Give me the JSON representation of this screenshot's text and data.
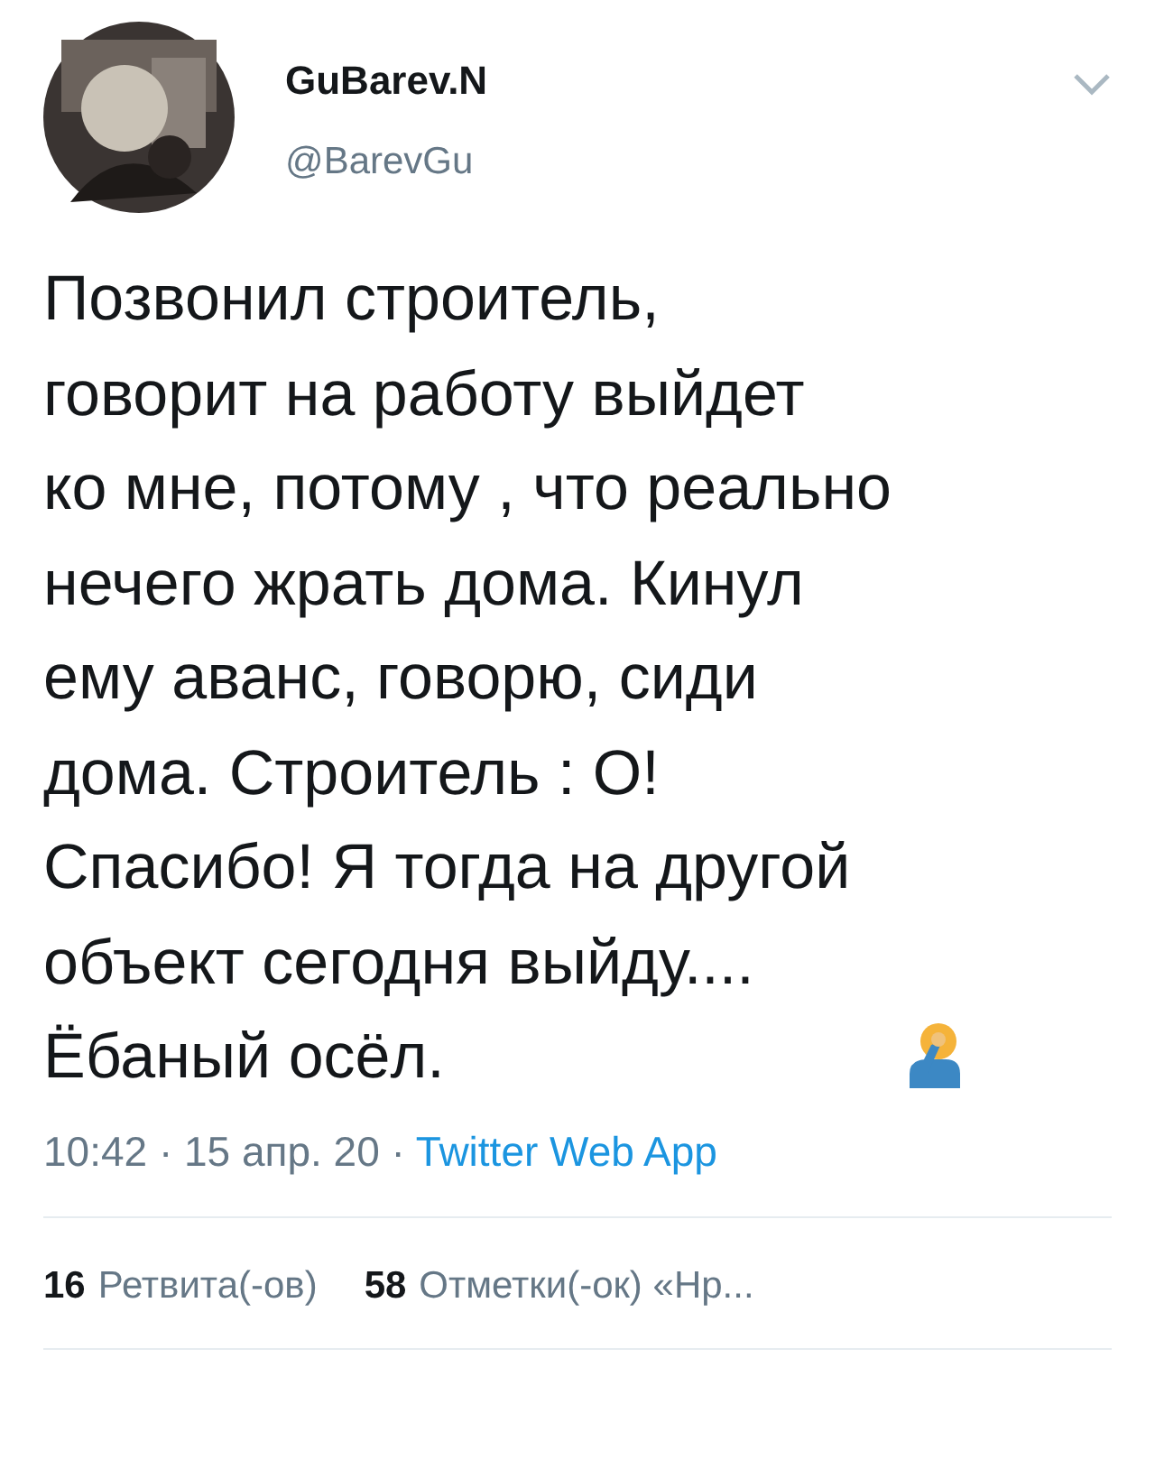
{
  "author": {
    "name": "GuBarev.N",
    "handle": "@BarevGu"
  },
  "body": "Позвонил строитель,\nговорит на работу выйдет\nко мне, потому , что реально\nнечего жрать дома. Кинул\nему аванс, говорю, сиди\nдома. Строитель : О!\nСпасибо! Я тогда на другой\nобъект сегодня выйду....\nЁбаный осёл.",
  "meta": {
    "timestamp": "10:42 · 15 апр. 20 ·",
    "source": "Twitter Web App"
  },
  "stats": [
    {
      "count": "16",
      "label": "Ретвита(-ов)"
    },
    {
      "count": "58",
      "label": "Отметки(-ок) «Нр..."
    }
  ]
}
